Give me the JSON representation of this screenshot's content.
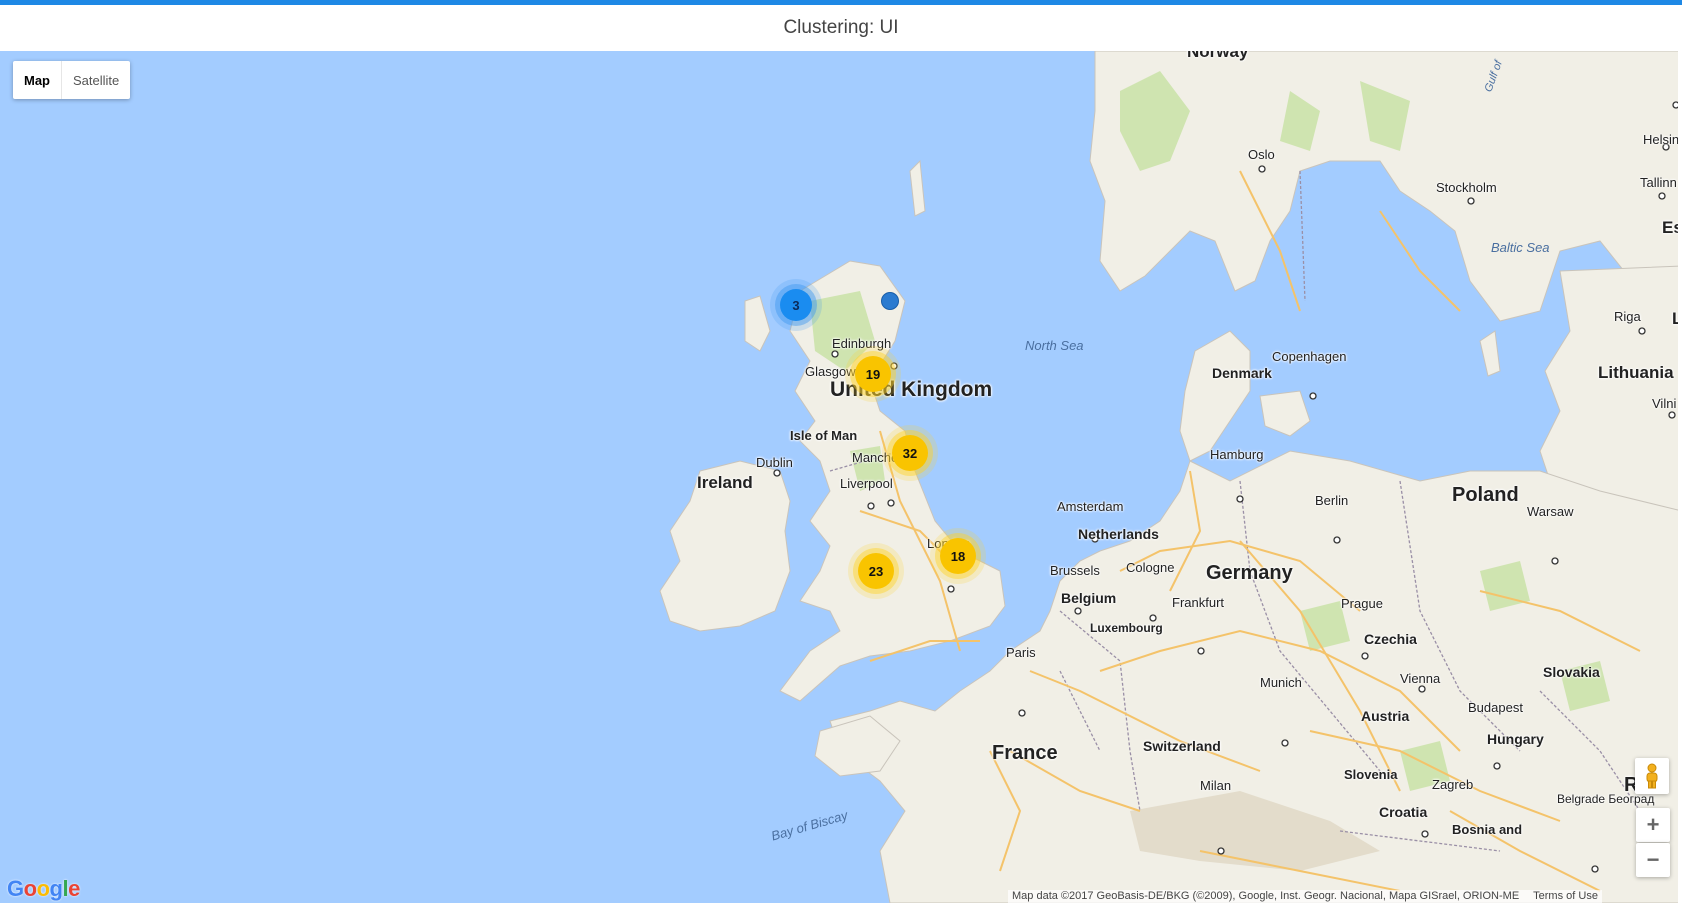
{
  "page": {
    "title": "Clustering: UI"
  },
  "map_type": {
    "map_label": "Map",
    "satellite_label": "Satellite",
    "selected": "Map"
  },
  "clusters": [
    {
      "id": "c3",
      "count": "3",
      "color": "#1a8cf0"
    },
    {
      "id": "c19",
      "count": "19",
      "color": "#f9c400"
    },
    {
      "id": "c32",
      "count": "32",
      "color": "#f9c400"
    },
    {
      "id": "c23",
      "count": "23",
      "color": "#f9c400"
    },
    {
      "id": "c18",
      "count": "18",
      "color": "#f9c400"
    }
  ],
  "single_marker": {
    "color": "#2b7bd0"
  },
  "places": {
    "norway": "Norway",
    "oslo": "Oslo",
    "stockholm": "Stockholm",
    "helsinki": "Helsin",
    "tallinn": "Tallinn",
    "estonia": "Est",
    "baltic_sea": "Baltic Sea",
    "riga": "Riga",
    "latvia": "L",
    "north_sea": "North Sea",
    "edinburgh": "Edinburgh",
    "glasgow": "Glasgow",
    "uk": "United Kingdom",
    "isle_of_man": "Isle of Man",
    "ireland": "Ireland",
    "dublin": "Dublin",
    "manchester": "Manchester",
    "liverpool": "Liverpool",
    "london": "London",
    "copenhagen": "Copenhagen",
    "denmark": "Denmark",
    "lithuania": "Lithuania",
    "vilnius": "Vilni",
    "hamburg": "Hamburg",
    "amsterdam": "Amsterdam",
    "netherlands": "Netherlands",
    "berlin": "Berlin",
    "poland": "Poland",
    "warsaw": "Warsaw",
    "brussels": "Brussels",
    "cologne": "Cologne",
    "germany": "Germany",
    "belgium": "Belgium",
    "frankfurt": "Frankfurt",
    "luxembourg": "Luxembourg",
    "prague": "Prague",
    "czechia": "Czechia",
    "paris": "Paris",
    "slovakia": "Slovakia",
    "vienna": "Vienna",
    "munich": "Munich",
    "austria": "Austria",
    "budapest": "Budapest",
    "hungary": "Hungary",
    "france": "France",
    "switzerland": "Switzerland",
    "slovenia": "Slovenia",
    "zagreb": "Zagreb",
    "milan": "Milan",
    "croatia": "Croatia",
    "belgrade": "Belgrade Београд",
    "bosnia": "Bosnia and",
    "bay_of_biscay": "Bay of Biscay",
    "gulf": "Gulf of",
    "romania": "R"
  },
  "controls": {
    "zoom_in": "+",
    "zoom_out": "−",
    "pegman_icon": "pegman-icon"
  },
  "footer": {
    "attribution": "Map data ©2017 GeoBasis-DE/BKG (©2009), Google, Inst. Geogr. Nacional, Mapa GISrael, ORION-ME",
    "terms": "Terms of Use",
    "logo_letters": [
      "G",
      "o",
      "o",
      "g",
      "l",
      "e"
    ],
    "logo_colors": [
      "#4285f4",
      "#ea4335",
      "#fbbc05",
      "#4285f4",
      "#34a853",
      "#ea4335"
    ]
  },
  "colors": {
    "water": "#a3ccff",
    "land": "#f1efe6",
    "park": "#cfe4b0",
    "border": "#9a8fa6",
    "road": "#f4c36a",
    "accent": "#1e88e5"
  }
}
